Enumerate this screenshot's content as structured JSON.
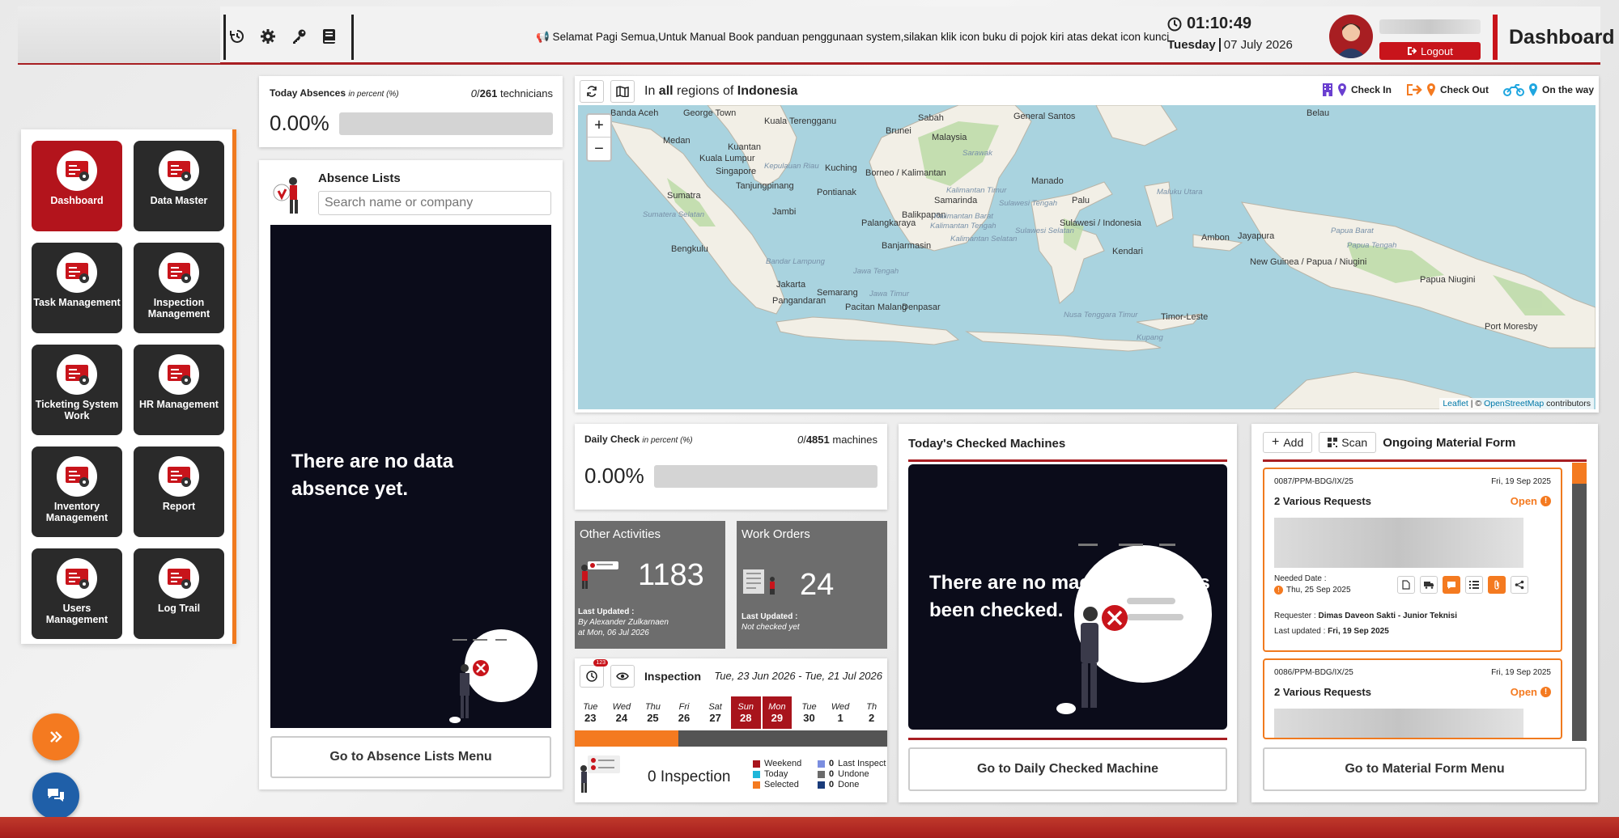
{
  "topbar": {
    "announcement": "📢 Selamat Pagi Semua,Untuk Manual Book panduan penggunaan system,silakan klik icon buku di pojok kiri atas dekat icon kunci",
    "time": "01:10:49",
    "day": "Tuesday",
    "date": "07 July 2026",
    "logout_label": "Logout",
    "page_title": "Dashboard"
  },
  "sidebar": {
    "items": [
      {
        "label": "Dashboard"
      },
      {
        "label": "Data Master"
      },
      {
        "label": "Task Management"
      },
      {
        "label": "Inspection Management"
      },
      {
        "label": "Ticketing System Work"
      },
      {
        "label": "HR Management"
      },
      {
        "label": "Inventory Management"
      },
      {
        "label": "Report"
      },
      {
        "label": "Users Management"
      },
      {
        "label": "Log Trail"
      }
    ]
  },
  "absences": {
    "title": "Today Absences",
    "unit": "in percent (%)",
    "count": "0",
    "total": "261",
    "suffix": "technicians",
    "percent": "0.00%",
    "fill": 0
  },
  "absence_list": {
    "title": "Absence Lists",
    "search_placeholder": "Search name or company",
    "empty_message": "There are no data absence yet.",
    "button": "Go to Absence Lists Menu"
  },
  "map": {
    "header_prefix": "In",
    "header_all": "all",
    "header_mid": "regions of",
    "header_country": "Indonesia",
    "legend": [
      "Check In",
      "Check Out",
      "On the way"
    ],
    "attribution_leaflet": "Leaflet",
    "attribution_osm": "OpenStreetMap",
    "attribution_suffix": "contributors",
    "attribution_sep": "| ©",
    "zoom_in": "+",
    "zoom_out": "−",
    "places": [
      "Banda Aceh",
      "George Town",
      "Kuala Terengganu",
      "Medan",
      "Kuantan",
      "Kuala Lumpur",
      "Singapore",
      "Kepulauan Riau",
      "Tanjungpinang",
      "Sumatra",
      "Jambi",
      "Bengkulu",
      "Bandar Lampung",
      "Jakarta",
      "Pangandaran",
      "Semarang",
      "Pacitan",
      "Malang",
      "Denpasar",
      "Kuching",
      "Borneo / Kalimantan",
      "Pontianak",
      "Palangkaraya",
      "Banjarmasin",
      "Balikpapan",
      "Samarinda",
      "Brunei",
      "Malaysia",
      "Sabah",
      "General Santos",
      "Manado",
      "Palu",
      "Sulawesi / Indonesia",
      "Kendari",
      "Ambon",
      "Timor-Leste",
      "Kupang",
      "Nusa Tenggara Timur",
      "Jayapura",
      "New Guinea / Papua / Niugini",
      "Papua Niugini",
      "Port Moresby",
      "Belau",
      "Papua Tengah",
      "Sumatera Selatan",
      "Kalimantan Barat",
      "Kalimantan Tengah",
      "Kalimantan Selatan",
      "Kalimantan Timur",
      "Sulawesi Tengah",
      "Sulawesi Selatan",
      "Jawa Tengah",
      "Jawa Timur",
      "Sarawak",
      "Maluku Utara",
      "Papua Barat"
    ]
  },
  "daily_check": {
    "title": "Daily Check",
    "unit": "in percent (%)",
    "count": "0",
    "total": "4851",
    "suffix": "machines",
    "percent": "0.00%",
    "fill": 0
  },
  "other_activities": {
    "title": "Other Activities",
    "value": "1183",
    "updated_label": "Last Updated :",
    "updated_by": "By Alexander Zulkarnaen",
    "updated_at": "at Mon, 06 Jul 2026"
  },
  "work_orders": {
    "title": "Work Orders",
    "value": "24",
    "updated_label": "Last Updated :",
    "updated_by": "Not checked yet"
  },
  "inspection": {
    "title": "Inspection",
    "badge": "123",
    "range": "Tue, 23 Jun 2026 - Tue, 21 Jul 2026",
    "days": [
      {
        "d": "Tue",
        "n": "23",
        "sel": false
      },
      {
        "d": "Wed",
        "n": "24",
        "sel": false
      },
      {
        "d": "Thu",
        "n": "25",
        "sel": false
      },
      {
        "d": "Fri",
        "n": "26",
        "sel": false
      },
      {
        "d": "Sat",
        "n": "27",
        "sel": false
      },
      {
        "d": "Sun",
        "n": "28",
        "sel": true
      },
      {
        "d": "Mon",
        "n": "29",
        "sel": true
      },
      {
        "d": "Tue",
        "n": "30",
        "sel": false
      },
      {
        "d": "Wed",
        "n": "1",
        "sel": false
      },
      {
        "d": "Th",
        "n": "2",
        "sel": false
      }
    ],
    "count_label": "0 Inspection",
    "legend_left": [
      {
        "label": "Weekend",
        "color": "#a8141c"
      },
      {
        "label": "Today",
        "color": "#1fb6d9"
      },
      {
        "label": "Selected",
        "color": "#f47a20"
      }
    ],
    "legend_right": [
      {
        "count": "0",
        "label": "Last Inspect",
        "color": "#7b8ee0"
      },
      {
        "count": "0",
        "label": "Undone",
        "color": "#6b6b6b"
      },
      {
        "count": "0",
        "label": "Done",
        "color": "#1a3b7a"
      }
    ]
  },
  "checked_machines": {
    "title": "Today's Checked Machines",
    "empty_message": "There are no machine that has been checked.",
    "button": "Go to Daily Checked Machine"
  },
  "material_form": {
    "add_label": "Add",
    "scan_label": "Scan",
    "title": "Ongoing Material Form",
    "button": "Go to Material Form Menu",
    "cards": [
      {
        "code": "0087/PPM-BDG/IX/25",
        "date": "Fri, 19 Sep 2025",
        "title": "2 Various Requests",
        "status": "Open",
        "needed_label": "Needed Date :",
        "needed_date": "Thu, 25 Sep 2025",
        "requester_label": "Requester :",
        "requester": "Dimas Daveon Sakti - Junior Teknisi",
        "updated_label": "Last updated :",
        "updated": "Fri, 19 Sep 2025"
      },
      {
        "code": "0086/PPM-BDG/IX/25",
        "date": "Fri, 19 Sep 2025",
        "title": "2 Various Requests",
        "status": "Open"
      }
    ]
  },
  "colors": {
    "brand_red": "#c8141b",
    "accent_orange": "#f47a20",
    "dark_panel": "#0b0c1a"
  }
}
